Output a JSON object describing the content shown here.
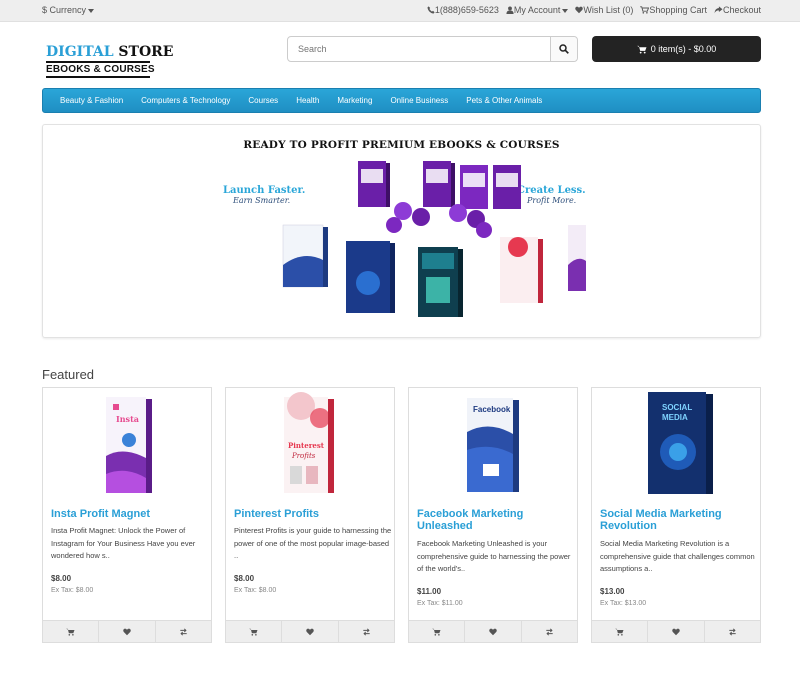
{
  "topbar": {
    "currency_icon": "$",
    "currency_label": "Currency",
    "phone": "1(888)659-5623",
    "my_account": "My Account",
    "wish_list": "Wish List (0)",
    "shopping_cart": "Shopping Cart",
    "checkout": "Checkout"
  },
  "logo": {
    "line1_a": "DIGITAL",
    "line1_b": " STORE",
    "line2": "EBOOKS & COURSES"
  },
  "search": {
    "placeholder": "Search"
  },
  "cart": {
    "label": "0 item(s) - $0.00"
  },
  "nav": {
    "items": [
      "Beauty & Fashion",
      "Computers & Technology",
      "Courses",
      "Health",
      "Marketing",
      "Online Business",
      "Pets & Other Animals"
    ]
  },
  "banner": {
    "headline": "READY TO PROFIT PREMIUM EBOOKS & COURSES",
    "left_tag_1": "Launch Faster.",
    "left_tag_2": "Earn Smarter.",
    "right_tag_1": "Create Less.",
    "right_tag_2": "Profit More."
  },
  "featured": {
    "title": "Featured",
    "products": [
      {
        "name": "Insta Profit Magnet",
        "desc": "Insta Profit Magnet: Unlock the Power of Instagram for Your Business Have you ever wondered how s..",
        "price": "$8.00",
        "extax": "Ex Tax: $8.00"
      },
      {
        "name": "Pinterest Profits",
        "desc": "Pinterest Profits is your guide to harnessing the power of one of the most popular image-based ..",
        "price": "$8.00",
        "extax": "Ex Tax: $8.00"
      },
      {
        "name": "Facebook Marketing Unleashed",
        "desc": "Facebook Marketing Unleashed is your comprehensive guide to harnessing the power of the world's..",
        "price": "$11.00",
        "extax": "Ex Tax: $11.00"
      },
      {
        "name": "Social Media Marketing Revolution",
        "desc": "Social Media Marketing Revolution is a comprehensive guide that challenges common assumptions a..",
        "price": "$13.00",
        "extax": "Ex Tax: $13.00"
      }
    ]
  },
  "colors": {
    "accent": "#2a9fd6",
    "nav": "#2aa6d8",
    "cart_button": "#232323"
  },
  "icons": {
    "cart": "cart-icon",
    "wishlist": "heart-icon",
    "compare": "exchange-icon",
    "search": "search-icon",
    "phone": "phone-icon",
    "user": "user-icon"
  }
}
